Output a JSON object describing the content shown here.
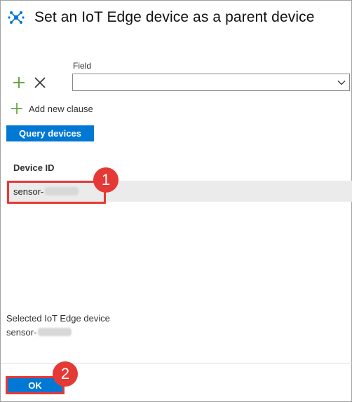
{
  "header": {
    "title": "Set an IoT Edge device as a parent device",
    "icon": "iot-edge-icon"
  },
  "filter": {
    "field_label": "Field",
    "field_value": "",
    "add_clause_label": "Add new clause"
  },
  "actions": {
    "query_label": "Query devices",
    "ok_label": "OK"
  },
  "table": {
    "column_header": "Device ID",
    "rows": [
      {
        "device_id": "sensor-"
      }
    ]
  },
  "selection": {
    "label": "Selected IoT Edge device",
    "value": "sensor-"
  },
  "callouts": {
    "first": "1",
    "second": "2"
  },
  "colors": {
    "accent": "#0078d4",
    "callout": "#e53935",
    "plus": "#5c9e31"
  }
}
